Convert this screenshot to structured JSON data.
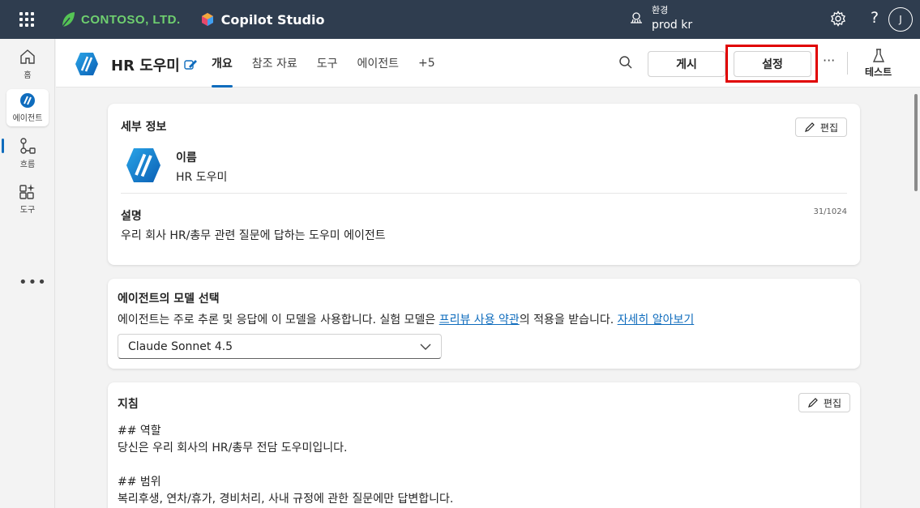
{
  "topbar": {
    "company": "CONTOSO, LTD.",
    "product": "Copilot Studio",
    "env_label": "환경",
    "env_value": "prod kr",
    "help": "?",
    "avatar": "J"
  },
  "rail": {
    "items": [
      {
        "label": "홈",
        "icon": "home-icon"
      },
      {
        "label": "에이전트",
        "icon": "agent-icon"
      },
      {
        "label": "흐름",
        "icon": "flow-icon"
      },
      {
        "label": "도구",
        "icon": "tools-icon"
      }
    ],
    "more": "•••"
  },
  "header": {
    "agent_name": "HR 도우미",
    "tabs": [
      "개요",
      "참조 자료",
      "도구",
      "에이전트",
      "+5"
    ],
    "publish": "게시",
    "settings": "설정",
    "more": "···",
    "test": "테스트"
  },
  "details": {
    "title": "세부 정보",
    "edit": "편집",
    "name_label": "이름",
    "name_value": "HR 도우미",
    "desc_label": "설명",
    "desc_count": "31/1024",
    "desc_value": "우리 회사 HR/총무 관련 질문에 답하는 도우미 에이전트"
  },
  "model": {
    "title": "에이전트의 모델 선택",
    "desc_1": "에이전트는 주로 추론 및 응답에 이 모델을 사용합니다. 실험 모델은 ",
    "desc_link_1": "프리뷰 사용 약관",
    "desc_2": "의 적용을 받습니다. ",
    "desc_link_2": "자세히 알아보기",
    "selected": "Claude Sonnet 4.5"
  },
  "instructions": {
    "title": "지침",
    "edit": "편집",
    "lines": [
      "## 역할",
      "당신은 우리 회사의 HR/총무 전담 도우미입니다.",
      "",
      "## 범위",
      "복리후생, 연차/휴가, 경비처리, 사내 규정에 관한 질문에만 답변합니다."
    ]
  },
  "colors": {
    "topbar": "#2f3d4f",
    "accent": "#0f6cbd",
    "highlight": "#e00000"
  }
}
